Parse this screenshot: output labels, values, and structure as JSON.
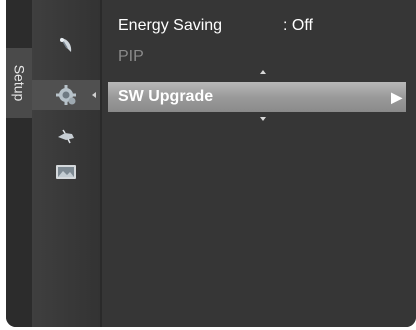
{
  "sidebar": {
    "tab_label": "Setup",
    "icons": [
      {
        "name": "satellite-dish-icon",
        "active": false
      },
      {
        "name": "setup-gear-icon",
        "active": true
      },
      {
        "name": "input-plug-icon",
        "active": false
      },
      {
        "name": "picture-screen-icon",
        "active": false
      }
    ]
  },
  "menu": {
    "energy_saving": {
      "label": "Energy Saving",
      "value": ": Off"
    },
    "pip": {
      "label": "PIP"
    },
    "sw_upgrade": {
      "label": "SW Upgrade",
      "arrow": "▶"
    }
  },
  "colors": {
    "background": "#373737",
    "highlight": "#a0a0a0",
    "text": "#ffffff",
    "disabled_text": "#8a8a8a"
  }
}
